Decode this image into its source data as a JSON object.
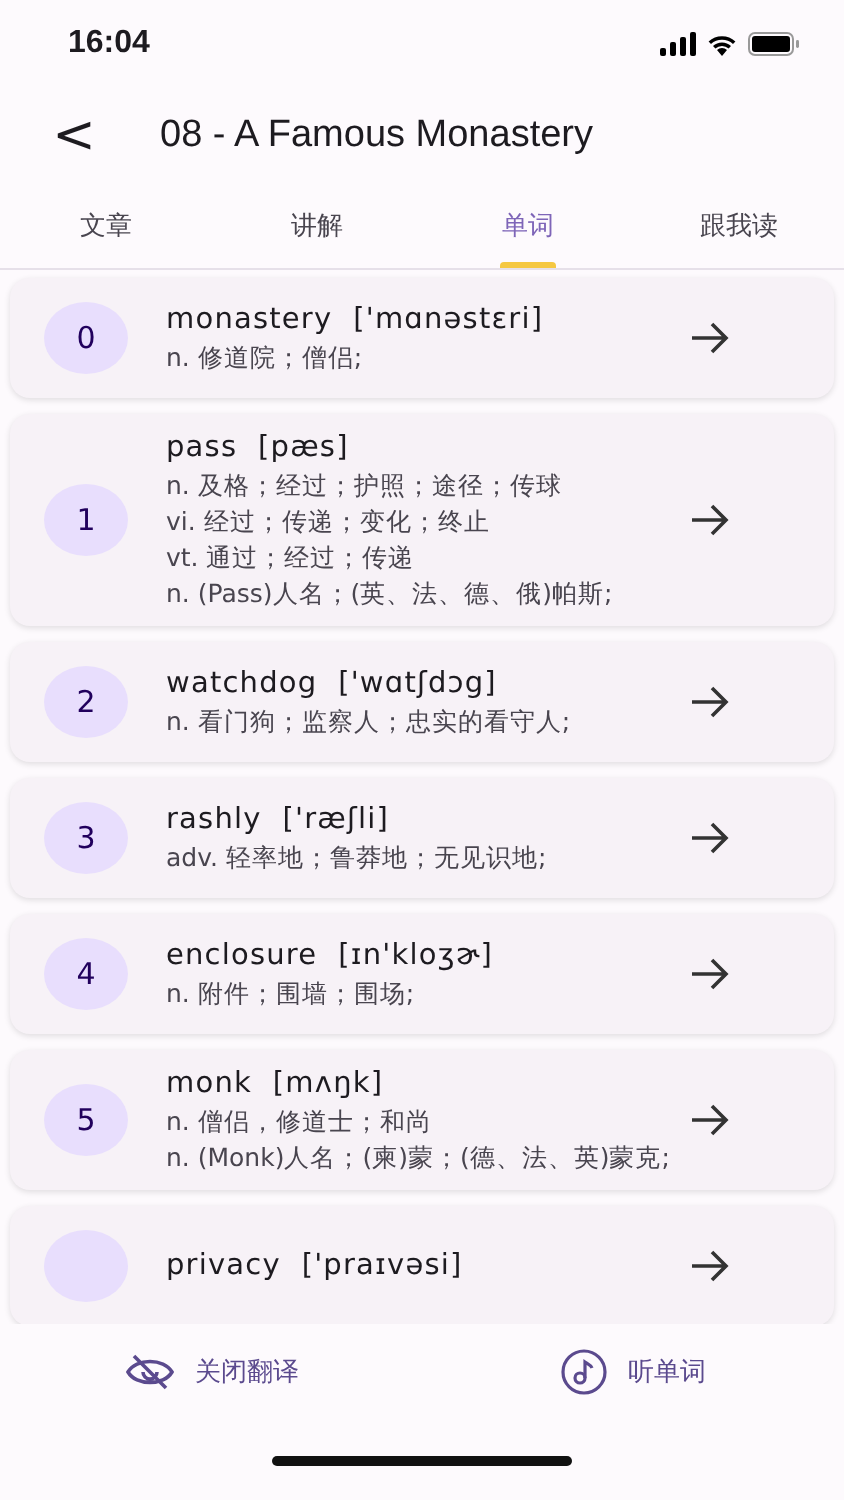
{
  "status_bar": {
    "time": "16:04"
  },
  "header": {
    "back": "<",
    "title": "08 - A Famous Monastery"
  },
  "tabs": [
    {
      "label": "文章",
      "selected": false
    },
    {
      "label": "讲解",
      "selected": false
    },
    {
      "label": "单词",
      "selected": true
    },
    {
      "label": "跟我读",
      "selected": false
    }
  ],
  "words": [
    {
      "index": "0",
      "word": "monastery",
      "phonetic": "['mɑnəstɛri]",
      "definitions": [
        "n. 修道院；僧侣;"
      ]
    },
    {
      "index": "1",
      "word": "pass",
      "phonetic": "[pæs]",
      "definitions": [
        "n. 及格；经过；护照；途径；传球",
        "vi. 经过；传递；变化；终止",
        "vt. 通过；经过；传递",
        "n. (Pass)人名；(英、法、德、俄)帕斯;"
      ]
    },
    {
      "index": "2",
      "word": "watchdog",
      "phonetic": "['wɑtʃdɔg]",
      "definitions": [
        "n. 看门狗；监察人；忠实的看守人;"
      ]
    },
    {
      "index": "3",
      "word": "rashly",
      "phonetic": "['ræʃli]",
      "definitions": [
        "adv. 轻率地；鲁莽地；无见识地;"
      ]
    },
    {
      "index": "4",
      "word": "enclosure",
      "phonetic": "[ɪn'kloʒɚ]",
      "definitions": [
        "n. 附件；围墙；围场;"
      ]
    },
    {
      "index": "5",
      "word": "monk",
      "phonetic": "[mʌŋk]",
      "definitions": [
        "n. 僧侣，修道士；和尚",
        "n. (Monk)人名；(柬)蒙；(德、法、英)蒙克;"
      ]
    },
    {
      "word": "privacy",
      "phonetic": "['praɪvəsi]"
    }
  ],
  "bottom_bar": [
    {
      "kind": "eye-off",
      "label": "关闭翻译"
    },
    {
      "kind": "music",
      "label": "听单词"
    }
  ]
}
